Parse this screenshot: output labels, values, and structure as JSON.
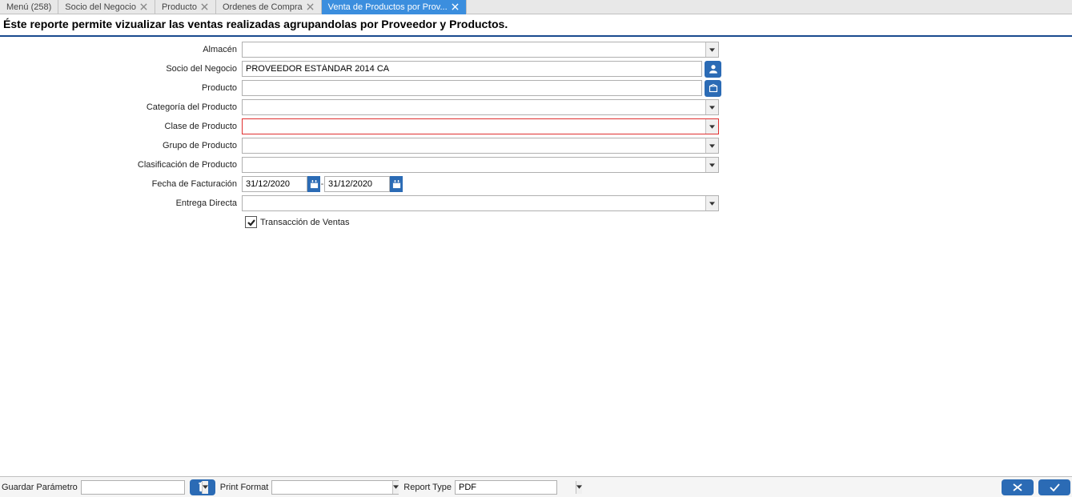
{
  "tabs": [
    {
      "label": "Menú (258)",
      "closable": false
    },
    {
      "label": "Socio del Negocio",
      "closable": true
    },
    {
      "label": "Producto",
      "closable": true
    },
    {
      "label": "Ordenes de Compra",
      "closable": true
    },
    {
      "label": "Venta de Productos por Prov...",
      "closable": true,
      "active": true
    }
  ],
  "header": {
    "description": "Éste reporte permite vizualizar las ventas realizadas agrupandolas por Proveedor y Productos."
  },
  "form": {
    "almacen": {
      "label": "Almacén",
      "value": ""
    },
    "socio": {
      "label": "Socio del Negocio",
      "value": "PROVEEDOR ESTÁNDAR 2014 CA"
    },
    "producto": {
      "label": "Producto",
      "value": ""
    },
    "categoria": {
      "label": "Categoría del Producto",
      "value": ""
    },
    "clase": {
      "label": "Clase de Producto",
      "value": ""
    },
    "grupo": {
      "label": "Grupo de Producto",
      "value": ""
    },
    "clasificacion": {
      "label": "Clasificación de Producto",
      "value": ""
    },
    "fecha": {
      "label": "Fecha de Facturación",
      "from": "31/12/2020",
      "to": "31/12/2020",
      "sep": "-"
    },
    "entrega": {
      "label": "Entrega Directa",
      "value": ""
    },
    "transaccion": {
      "label": "Transacción de Ventas",
      "checked": true
    }
  },
  "footer": {
    "guardar": {
      "label": "Guardar Parámetro",
      "value": ""
    },
    "printformat": {
      "label": "Print Format",
      "value": ""
    },
    "reporttype": {
      "label": "Report Type",
      "value": "PDF"
    }
  }
}
